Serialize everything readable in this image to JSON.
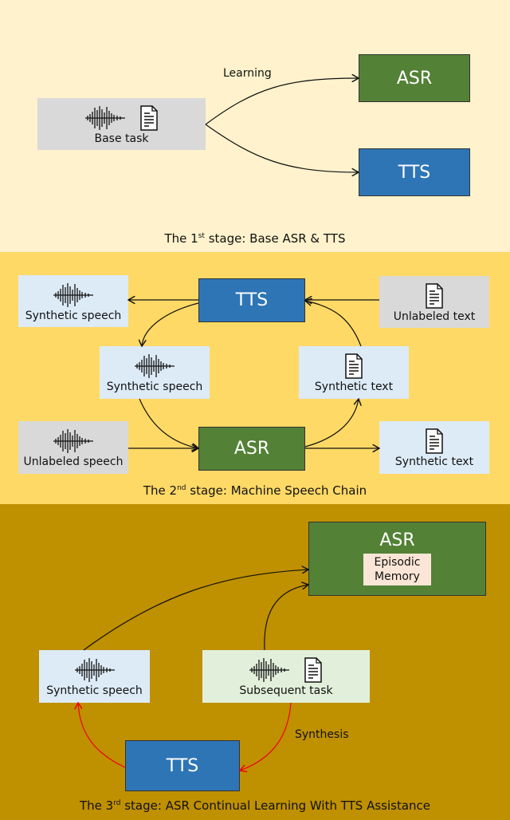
{
  "stage1": {
    "caption_pre": "The 1",
    "caption_sup": "st",
    "caption_post": " stage: Base ASR & TTS",
    "base_task": "Base task",
    "asr": "ASR",
    "tts": "TTS",
    "learning": "Learning"
  },
  "stage2": {
    "caption_pre": "The 2",
    "caption_sup": "nd",
    "caption_post": " stage: Machine Speech Chain",
    "tts": "TTS",
    "asr": "ASR",
    "synthetic_speech": "Synthetic speech",
    "unlabeled_text": "Unlabeled text",
    "synthetic_text": "Synthetic text",
    "unlabeled_speech": "Unlabeled speech"
  },
  "stage3": {
    "caption_pre": "The 3",
    "caption_sup": "rd",
    "caption_post": " stage: ASR Continual Learning With TTS Assistance",
    "asr": "ASR",
    "memory_line1": "Episodic",
    "memory_line2": "Memory",
    "synthetic_speech": "Synthetic speech",
    "subsequent_task": "Subsequent task",
    "tts": "TTS",
    "synthesis": "Synthesis"
  },
  "colors": {
    "stage1_bg": "#fff2cc",
    "stage2_bg": "#ffd966",
    "stage3_bg": "#bf9000",
    "asr": "#538135",
    "tts": "#2e75b6",
    "synthesis_arrow": "#ff0000"
  },
  "icons": [
    "waveform-icon",
    "document-icon"
  ]
}
